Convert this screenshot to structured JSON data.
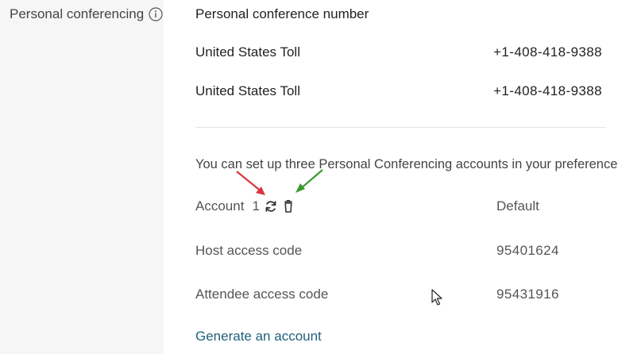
{
  "section": {
    "label": "Personal conferencing",
    "info_icon": "info-icon"
  },
  "conference": {
    "heading": "Personal conference number",
    "numbers": [
      {
        "label": "United States Toll",
        "value": "+1-408-418-9388"
      },
      {
        "label": "United States Toll",
        "value": "+1-408-418-9388"
      }
    ]
  },
  "accounts": {
    "note": "You can set up three Personal Conferencing accounts in your preferences.",
    "account_label": "Account",
    "account_number": "1",
    "refresh_icon": "refresh-icon",
    "delete_icon": "trash-icon",
    "default_label": "Default",
    "host_label": "Host access code",
    "host_code": "95401624",
    "attendee_label": "Attendee access code",
    "attendee_code": "95431916",
    "generate_link": "Generate an account"
  },
  "colors": {
    "left_column_bg": "#f6f6f6",
    "link": "#1f5f7a",
    "annotation_red": "#d9363e",
    "annotation_green": "#3a9a2c"
  }
}
